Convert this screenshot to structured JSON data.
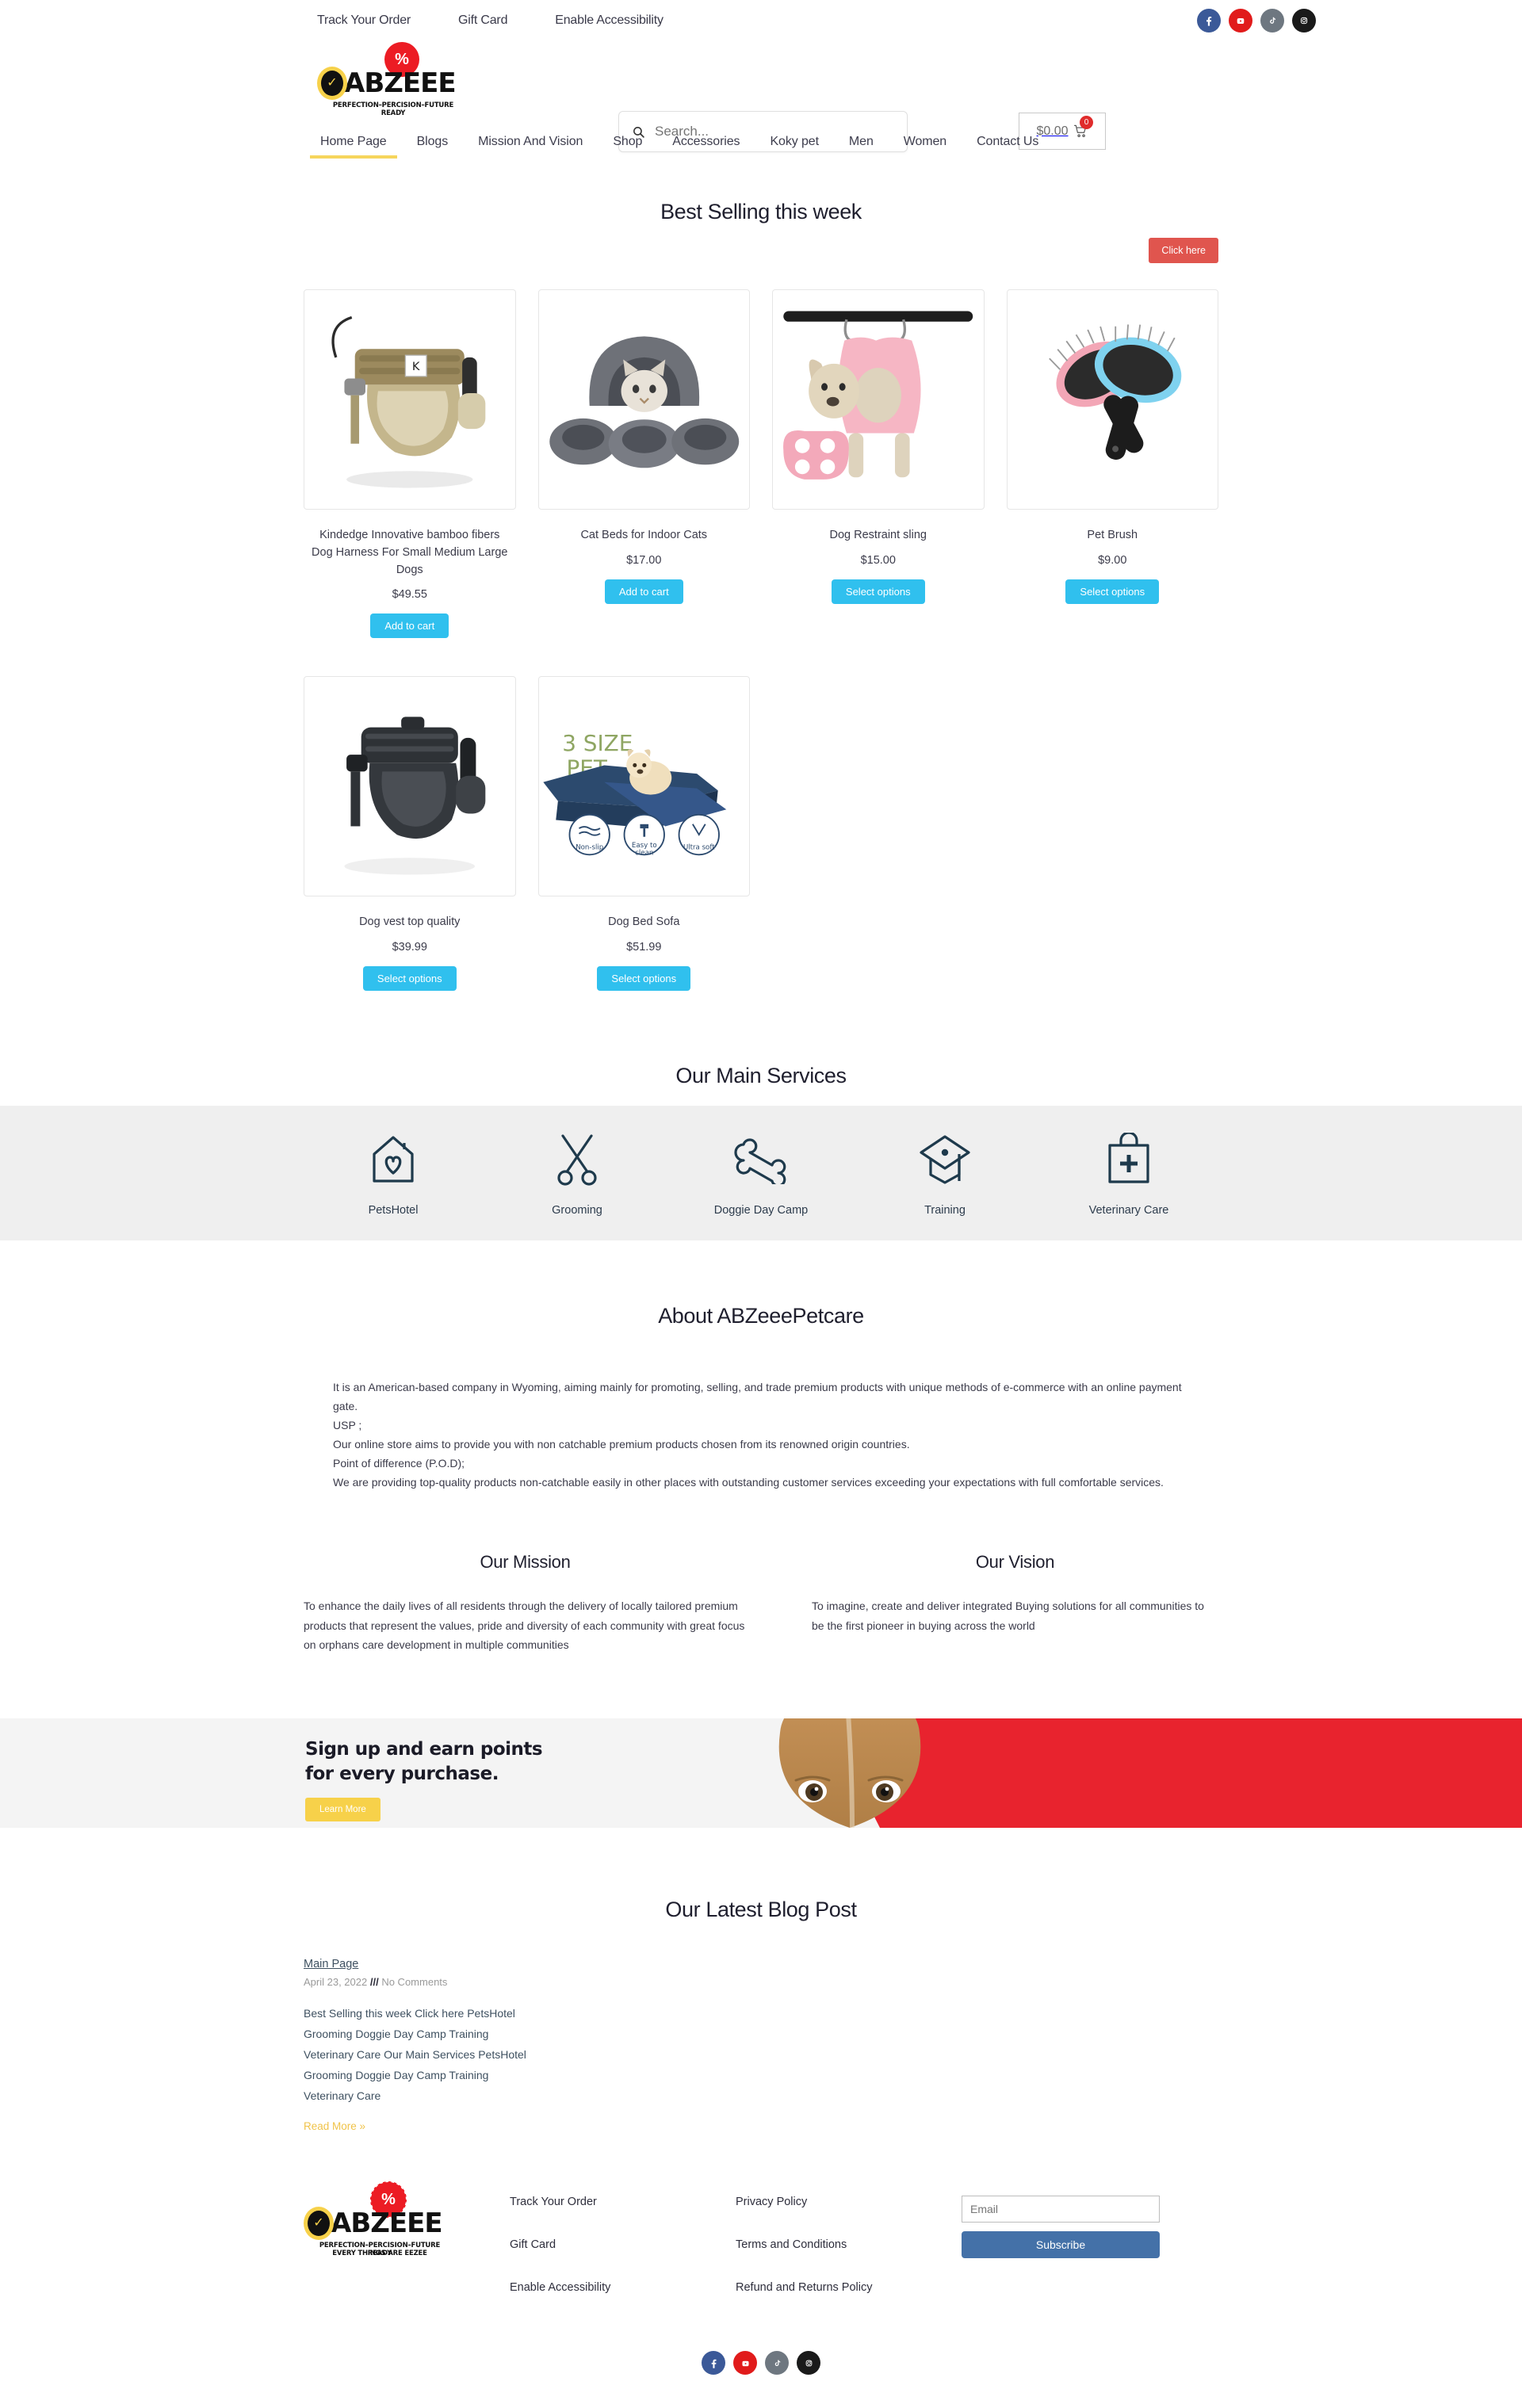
{
  "topbar": {
    "links": [
      {
        "label": "Track Your Order"
      },
      {
        "label": "Gift Card"
      },
      {
        "label": "Enable Accessibility"
      }
    ],
    "social": [
      {
        "name": "facebook-icon",
        "color": "#3b5998"
      },
      {
        "name": "youtube-icon",
        "color": "#e11b1b"
      },
      {
        "name": "tiktok-icon",
        "color": "#6e7780"
      },
      {
        "name": "instagram-icon",
        "color": "#1a1a1a"
      }
    ]
  },
  "brand": {
    "name": "ABZEEE",
    "badge": "%",
    "check": "✓",
    "tagline1": "PERFECTION–PERCISION–FUTURE READY",
    "tagline2": "EVERY THINGS ARE EEZEE"
  },
  "search": {
    "placeholder": "Search...",
    "value": ""
  },
  "cart": {
    "amount": "$0.00",
    "count": "0"
  },
  "nav": [
    {
      "label": "Home Page",
      "active": true
    },
    {
      "label": "Blogs",
      "active": false
    },
    {
      "label": "Mission And Vision",
      "active": false
    },
    {
      "label": "Shop",
      "active": false
    },
    {
      "label": "Accessories",
      "active": false
    },
    {
      "label": "Koky pet",
      "active": false
    },
    {
      "label": "Men",
      "active": false
    },
    {
      "label": "Women",
      "active": false
    },
    {
      "label": "Contact Us",
      "active": false
    }
  ],
  "bestselling": {
    "title": "Best Selling this week",
    "click_here": "Click here",
    "products": [
      {
        "name": "Kindedge Innovative bamboo fibers Dog Harness For Small Medium Large Dogs",
        "price": "$49.55",
        "button": "Add to cart",
        "image": "dog-harness-tan"
      },
      {
        "name": "Cat Beds for Indoor Cats",
        "price": "$17.00",
        "button": "Add to cart",
        "image": "cat-bed-grey"
      },
      {
        "name": "Dog Restraint sling",
        "price": "$15.00",
        "button": "Select options",
        "image": "dog-sling-pink"
      },
      {
        "name": "Pet Brush",
        "price": "$9.00",
        "button": "Select options",
        "image": "pet-brush"
      },
      {
        "name": "Dog vest top quality",
        "price": "$39.99",
        "button": "Select options",
        "image": "dog-vest-black"
      },
      {
        "name": "Dog Bed Sofa",
        "price": "$51.99",
        "button": "Select options",
        "image": "dog-bed-sofa"
      }
    ]
  },
  "services": {
    "title": "Our Main Services",
    "items": [
      {
        "label": "PetsHotel",
        "icon": "house-heart-icon"
      },
      {
        "label": "Grooming",
        "icon": "scissors-icon"
      },
      {
        "label": "Doggie Day Camp",
        "icon": "bone-icon"
      },
      {
        "label": "Training",
        "icon": "graduation-cap-icon"
      },
      {
        "label": "Veterinary Care",
        "icon": "medical-kit-icon"
      }
    ]
  },
  "about": {
    "title": "About ABZeeePetcare",
    "paragraphs": [
      "It is an American-based company in Wyoming, aiming mainly for promoting, selling, and trade premium products with unique methods of e-commerce with an online payment gate.",
      "USP ;",
      "Our online store aims to provide you with non catchable premium products chosen from its renowned origin countries.",
      "Point of difference (P.O.D);",
      "We are providing top-quality products non-catchable easily in other places with outstanding customer services exceeding your expectations with full comfortable services."
    ]
  },
  "mission": {
    "title": "Our Mission",
    "text": "To enhance the daily lives of all residents through the delivery of locally tailored premium products that represent the values, pride and diversity of each community with great focus on orphans care development in multiple communities"
  },
  "vision": {
    "title": "Our Vision",
    "text": "To imagine, create and deliver integrated Buying solutions for all communities to be the first pioneer in buying across the world"
  },
  "signup": {
    "line1": "Sign up and earn points",
    "line2": "for every purchase.",
    "button": "Learn More"
  },
  "blog": {
    "title": "Our Latest Blog Post",
    "category": "Main Page",
    "date": "April 23, 2022",
    "separator": "///",
    "comments": "No Comments",
    "lines": [
      "Best Selling this week Click here PetsHotel",
      "Grooming Doggie Day Camp Training",
      "Veterinary Care Our Main Services PetsHotel",
      "Grooming Doggie Day Camp Training",
      "Veterinary Care"
    ],
    "read_more": "Read More »"
  },
  "footer": {
    "column1": [
      {
        "label": "Track Your Order"
      },
      {
        "label": "Gift Card"
      },
      {
        "label": "Enable Accessibility"
      }
    ],
    "column2": [
      {
        "label": "Privacy Policy"
      },
      {
        "label": "Terms and Conditions"
      },
      {
        "label": "Refund and Returns Policy"
      }
    ],
    "newsletter": {
      "placeholder": "Email",
      "value": "",
      "button": "Subscribe"
    },
    "social": [
      {
        "name": "facebook-icon"
      },
      {
        "name": "youtube-icon"
      },
      {
        "name": "tiktok-icon"
      },
      {
        "name": "instagram-icon"
      }
    ]
  },
  "colors": {
    "accent_yellow": "#f7d14a",
    "accent_red": "#ec1c24",
    "button_blue": "#30c0ee",
    "click_red": "#e0554e",
    "subscribe_blue": "#4471a8",
    "services_bg": "#efefef"
  }
}
